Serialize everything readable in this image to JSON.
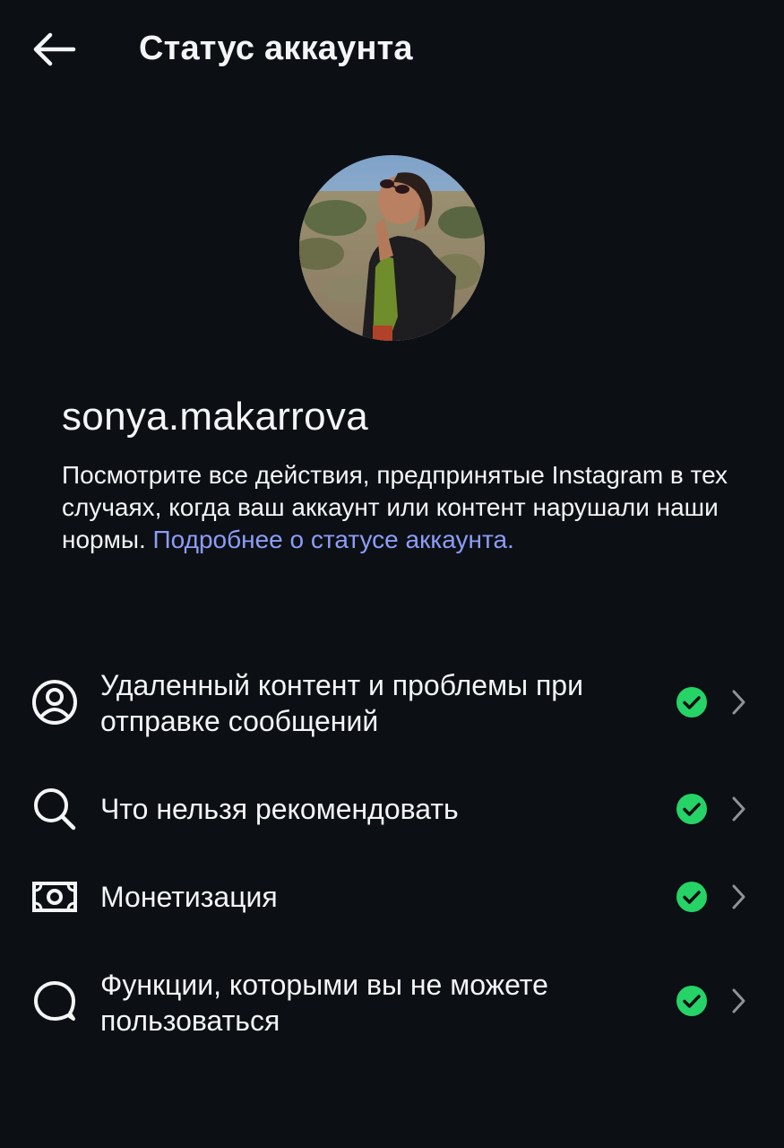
{
  "header": {
    "title": "Статус аккаунта",
    "back_icon": "arrow-left-icon"
  },
  "profile": {
    "username": "sonya.makarrova",
    "description_text": "Посмотрите все действия, предпринятые Instagram в тех случаях, когда ваш аккаунт или контент нарушали наши нормы. ",
    "description_link": "Подробнее о статусе аккаунта."
  },
  "menu": {
    "items": [
      {
        "label": "Удаленный контент и проблемы при отправке сообщений",
        "icon": "user-circle-icon",
        "status": "ok"
      },
      {
        "label": "Что нельзя рекомендовать",
        "icon": "search-icon",
        "status": "ok"
      },
      {
        "label": "Монетизация",
        "icon": "money-icon",
        "status": "ok"
      },
      {
        "label": "Функции, которыми вы не можете пользоваться",
        "icon": "chat-bubble-icon",
        "status": "ok"
      }
    ]
  },
  "colors": {
    "background": "#0c0f14",
    "text": "#f3f5f7",
    "link": "#8c9df7",
    "status_ok": "#25d366"
  }
}
